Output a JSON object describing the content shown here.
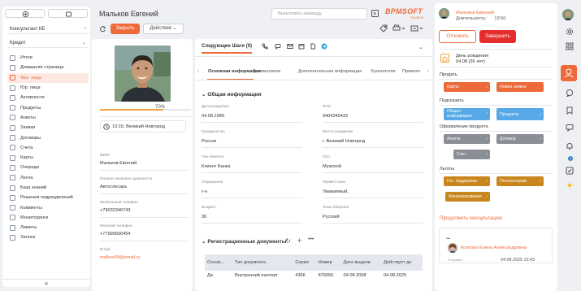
{
  "sidebar": {
    "context_dropdown": "Консультант КБ",
    "section_dropdown": "Кредит",
    "collapse_glyph": "«",
    "items": [
      {
        "label": "Итоги"
      },
      {
        "label": "Домашняя страница"
      },
      {
        "label": "Физ. лица",
        "active": true
      },
      {
        "label": "Юр. лица"
      },
      {
        "label": "Активности"
      },
      {
        "label": "Продукты"
      },
      {
        "label": "Анкеты"
      },
      {
        "label": "Заявки"
      },
      {
        "label": "Договоры"
      },
      {
        "label": "Счета"
      },
      {
        "label": "Карты"
      },
      {
        "label": "Очереди"
      },
      {
        "label": "Лента"
      },
      {
        "label": "База знаний"
      },
      {
        "label": "Решения подразделений"
      },
      {
        "label": "Комменты"
      },
      {
        "label": "Мониторинги"
      },
      {
        "label": "Лимиты"
      },
      {
        "label": "Залоги"
      }
    ]
  },
  "header": {
    "title": "Мальков Евгений",
    "command_placeholder": "Выполнить команду",
    "logo_main": "BPMSOFT",
    "logo_sub": "TRAINING",
    "close_button": "Закрыть",
    "actions_button": "Действия"
  },
  "profile": {
    "progress_text": "70%",
    "progress_value": 70,
    "time_location": "13:10, Великий Новгород",
    "fields": [
      {
        "label": "ФИО*",
        "value": "Мальков Евгений"
      },
      {
        "label": "Полное название должности",
        "value": "Автослесарь"
      },
      {
        "label": "Мобильный телефон",
        "value": "+79032346743"
      },
      {
        "label": "Рабочий телефон",
        "value": "+77999930454"
      },
      {
        "label": "Email",
        "value": "malkov69@email.ru"
      }
    ]
  },
  "center": {
    "next_steps_tab": "Следующие Шаги (0)",
    "tabs": [
      "Основная информация",
      "Взаимосвязи",
      "Дополнительная информация",
      "Хронология",
      "Привлеч"
    ],
    "general_title": "Общая информация",
    "fields": [
      {
        "label": "Дата рождения",
        "value": "04.08.1989"
      },
      {
        "label": "ИНН",
        "value": "9404345433"
      },
      {
        "label": "Гражданство",
        "value": "Россия"
      },
      {
        "label": "Место рождения",
        "value": "г. Великий Новгород"
      },
      {
        "label": "Тип клиента",
        "value": "Клиент Банка"
      },
      {
        "label": "Пол",
        "value": "Мужской"
      },
      {
        "label": "Обращение",
        "value": "г-н"
      },
      {
        "label": "Приветствие",
        "value": "Уважаемый,"
      },
      {
        "label": "Возраст",
        "value": "36"
      },
      {
        "label": "Язык общения",
        "value": "Русский"
      }
    ],
    "docs_title": "Регистрационные документы",
    "docs_columns": [
      "Основ...",
      "Тип документа",
      "Серия",
      "Номер",
      "Дата выдачи",
      "Действует до"
    ],
    "docs_rows": [
      [
        "Да",
        "Внутренний паспорт",
        "4366",
        "876656",
        "04.08.2008",
        "04.08.2025"
      ]
    ]
  },
  "right": {
    "user_name": "Мальков Евгений",
    "duration_label": "Длительность:",
    "duration_value": "13:50",
    "postpone_button": "Отложить",
    "finish_button": "Завершить",
    "birthday_label": "День рождения",
    "birthday_value": "04.08 (36 лет)",
    "sell_title": "Продать",
    "sell_items": [
      "Карты",
      "Новая заявка"
    ],
    "prompt_title": "Подсказать",
    "prompt_items": [
      "Общая информация",
      "Продукты"
    ],
    "process_title": "Оформление продукта",
    "process_items": [
      "Анкета",
      "Договор",
      "Счет"
    ],
    "benefits_title": "Льготы",
    "benefits_items": [
      "Гос. поддержка",
      "Пенсионерам",
      "Финансирование"
    ],
    "continue_link": "Продолжить консультацию",
    "feed_dots": "•••",
    "feed_author": "Козлова Елена Александровна",
    "feed_status": "Отправка",
    "feed_date": "04.08.2025 12:43"
  },
  "colors": {
    "accent": "#ee6a3a",
    "finish": "#e52d2d",
    "blue_chip": "#56a8e6",
    "gray_chip": "#8a8f96",
    "gold_chip": "#c9861c"
  }
}
